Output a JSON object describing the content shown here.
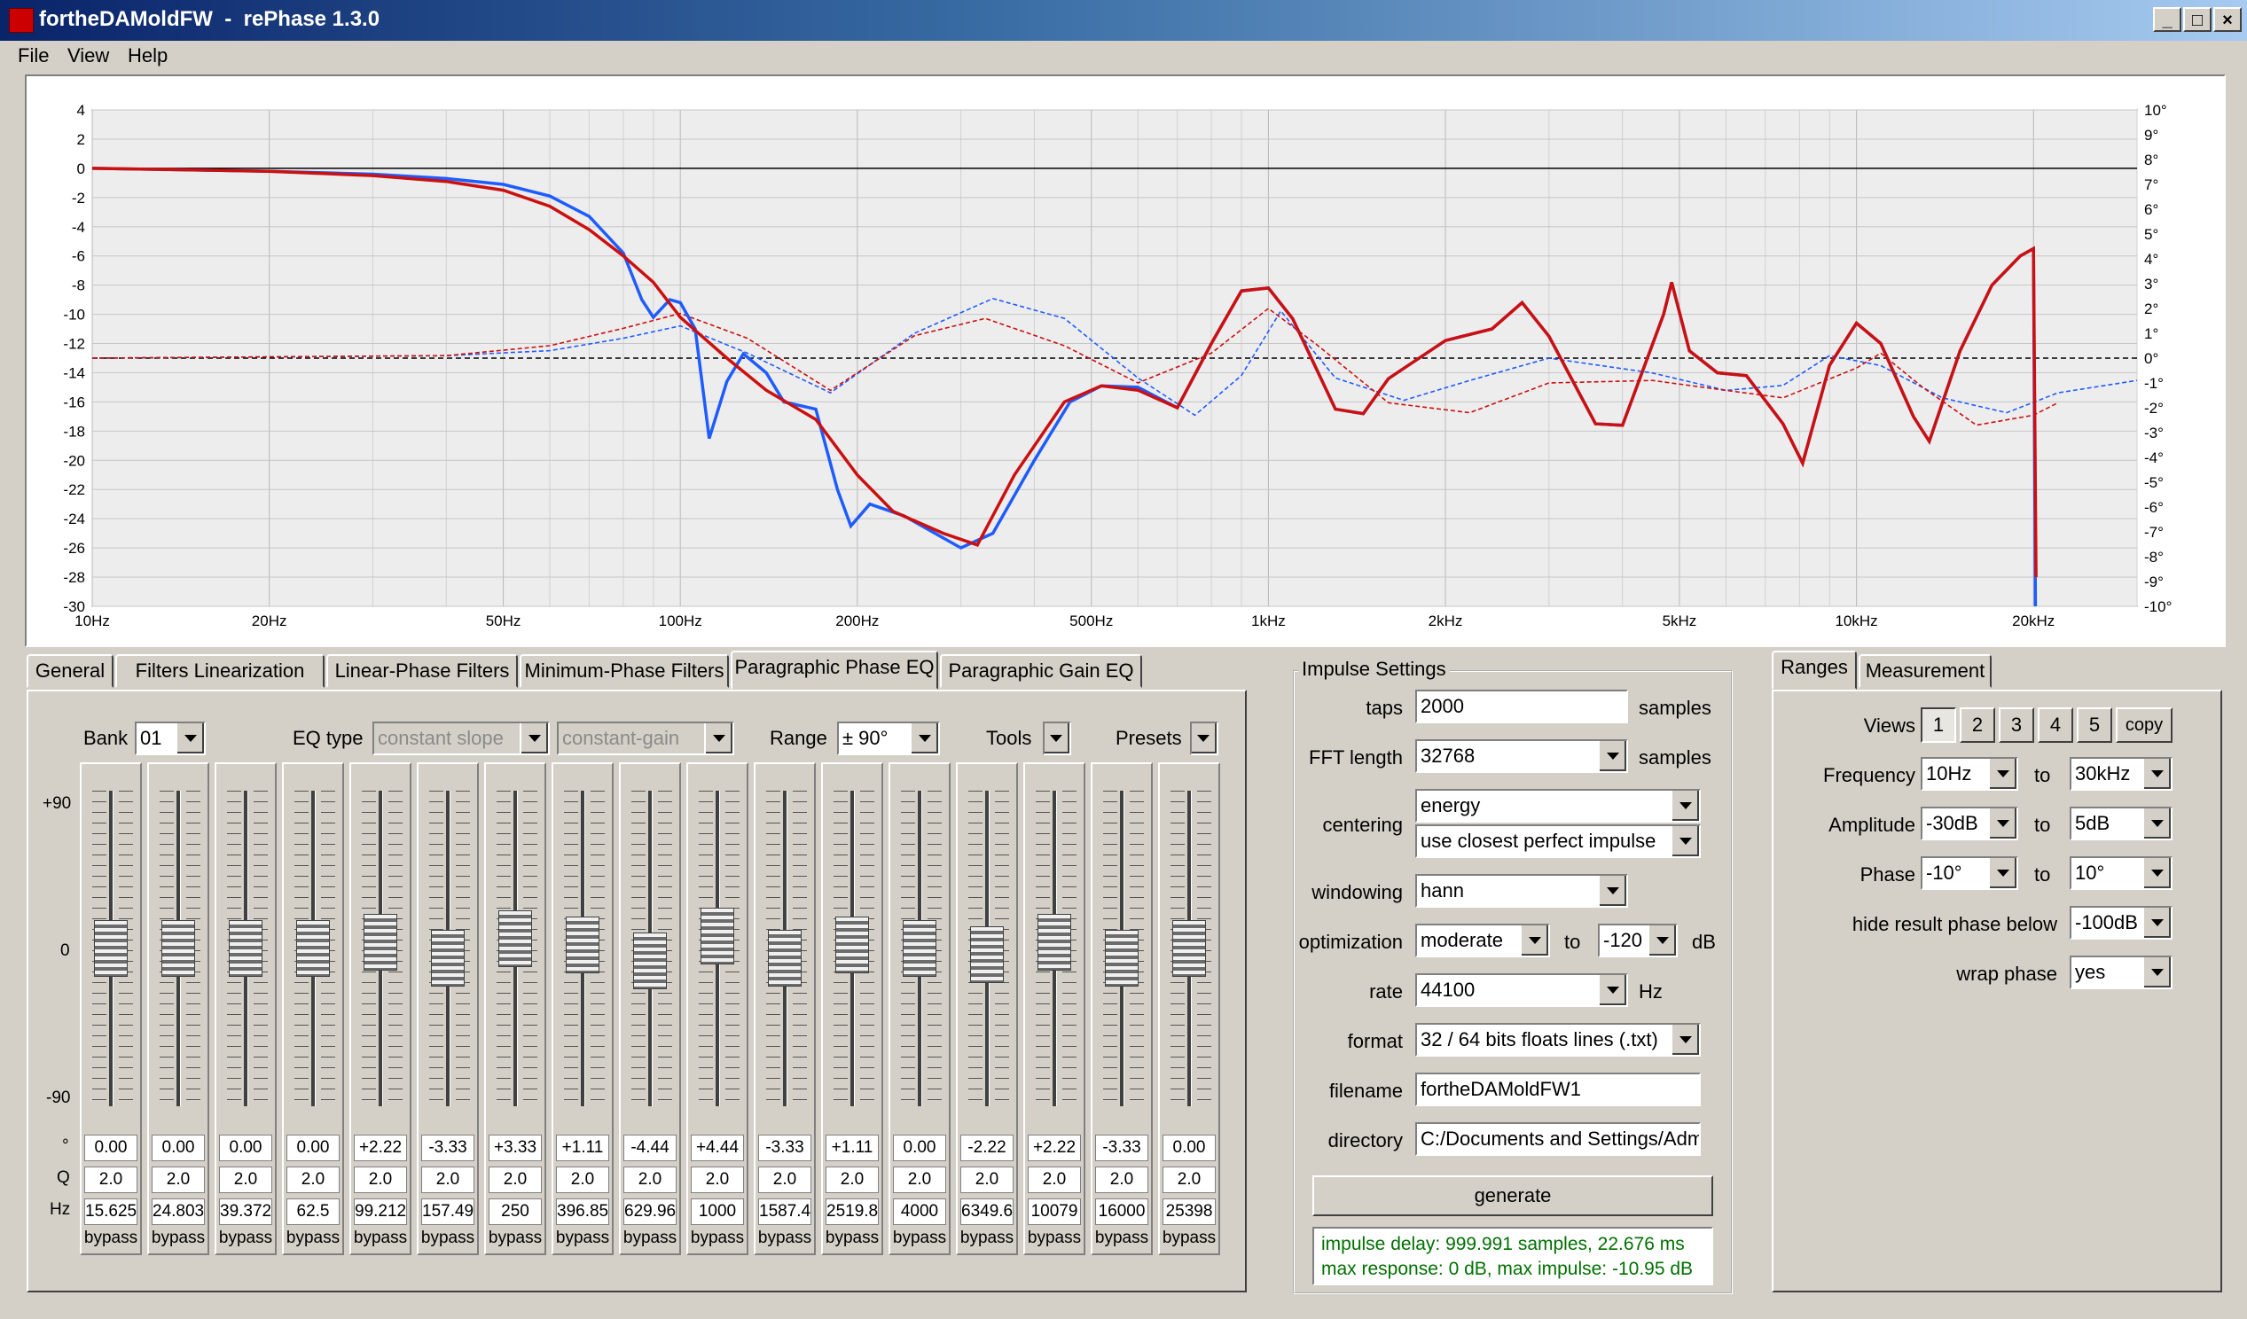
{
  "window": {
    "title": "fortheDAMoldFW  -  rePhase 1.3.0"
  },
  "menu": [
    "File",
    "View",
    "Help"
  ],
  "graph": {
    "left_ticks": [
      "4",
      "2",
      "0",
      "-2",
      "-4",
      "-6",
      "-8",
      "-10",
      "-12",
      "-14",
      "-16",
      "-18",
      "-20",
      "-22",
      "-24",
      "-26",
      "-28",
      "-30"
    ],
    "right_ticks": [
      "10°",
      "9°",
      "8°",
      "7°",
      "6°",
      "5°",
      "4°",
      "3°",
      "2°",
      "1°",
      "0°",
      "-1°",
      "-2°",
      "-3°",
      "-4°",
      "-5°",
      "-6°",
      "-7°",
      "-8°",
      "-9°",
      "-10°"
    ],
    "x_ticks": [
      "10Hz",
      "20Hz",
      "50Hz",
      "100Hz",
      "200Hz",
      "500Hz",
      "1kHz",
      "2kHz",
      "5kHz",
      "10kHz",
      "20kHz"
    ]
  },
  "tabs": [
    "General",
    "Filters Linearization",
    "Linear-Phase Filters",
    "Minimum-Phase Filters",
    "Paragraphic Phase EQ",
    "Paragraphic Gain EQ"
  ],
  "eq": {
    "bank_label": "Bank",
    "bank_value": "01",
    "eqtype_label": "EQ type",
    "eqtype_value1": "constant slope",
    "eqtype_value2": "constant-gain",
    "range_label": "Range",
    "range_value": "± 90°",
    "tools_label": "Tools",
    "presets_label": "Presets",
    "scale": [
      "+90",
      "0",
      "-90"
    ],
    "row_labels": [
      "°",
      "Q",
      "Hz"
    ],
    "bypass_label": "bypass",
    "bands": [
      {
        "deg": "0.00",
        "q": "2.0",
        "hz": "15.625",
        "level": 0
      },
      {
        "deg": "0.00",
        "q": "2.0",
        "hz": "24.803",
        "level": 0
      },
      {
        "deg": "0.00",
        "q": "2.0",
        "hz": "39.372",
        "level": 0
      },
      {
        "deg": "0.00",
        "q": "2.0",
        "hz": "62.5",
        "level": 0
      },
      {
        "deg": "+2.22",
        "q": "2.0",
        "hz": "99.212",
        "level": 2.22
      },
      {
        "deg": "-3.33",
        "q": "2.0",
        "hz": "157.49",
        "level": -3.33
      },
      {
        "deg": "+3.33",
        "q": "2.0",
        "hz": "250",
        "level": 3.33
      },
      {
        "deg": "+1.11",
        "q": "2.0",
        "hz": "396.85",
        "level": 1.11
      },
      {
        "deg": "-4.44",
        "q": "2.0",
        "hz": "629.96",
        "level": -4.44
      },
      {
        "deg": "+4.44",
        "q": "2.0",
        "hz": "1000",
        "level": 4.44
      },
      {
        "deg": "-3.33",
        "q": "2.0",
        "hz": "1587.4",
        "level": -3.33
      },
      {
        "deg": "+1.11",
        "q": "2.0",
        "hz": "2519.8",
        "level": 1.11
      },
      {
        "deg": "0.00",
        "q": "2.0",
        "hz": "4000",
        "level": 0
      },
      {
        "deg": "-2.22",
        "q": "2.0",
        "hz": "6349.6",
        "level": -2.22
      },
      {
        "deg": "+2.22",
        "q": "2.0",
        "hz": "10079",
        "level": 2.22
      },
      {
        "deg": "-3.33",
        "q": "2.0",
        "hz": "16000",
        "level": -3.33
      },
      {
        "deg": "0.00",
        "q": "2.0",
        "hz": "25398",
        "level": 0
      }
    ]
  },
  "impulse": {
    "title": "Impulse Settings",
    "taps_label": "taps",
    "taps_value": "2000",
    "samples1": "samples",
    "fft_label": "FFT length",
    "fft_value": "32768",
    "samples2": "samples",
    "centering_label": "centering",
    "centering_value1": "energy",
    "centering_value2": "use closest perfect impulse",
    "windowing_label": "windowing",
    "windowing_value": "hann",
    "optimization_label": "optimization",
    "optimization_value": "moderate",
    "to_label": "to",
    "optimization_to": "-120",
    "db_label": "dB",
    "rate_label": "rate",
    "rate_value": "44100",
    "hz_label": "Hz",
    "format_label": "format",
    "format_value": "32 / 64 bits floats lines (.txt)",
    "filename_label": "filename",
    "filename_value": "fortheDAMoldFW1",
    "directory_label": "directory",
    "directory_value": "C:/Documents and Settings/Admi",
    "generate_label": "generate",
    "status_line1": "impulse delay: 999.991 samples, 22.676 ms",
    "status_line2": "max response: 0 dB, max impulse: -10.95 dB"
  },
  "ranges": {
    "tabs": [
      "Ranges",
      "Measurement"
    ],
    "views_label": "Views",
    "views": [
      "1",
      "2",
      "3",
      "4",
      "5"
    ],
    "copy_label": "copy",
    "frequency_label": "Frequency",
    "freq_from": "10Hz",
    "freq_to": "30kHz",
    "amplitude_label": "Amplitude",
    "amp_from": "-30dB",
    "amp_to": "5dB",
    "phase_label": "Phase",
    "phase_from": "-10°",
    "phase_to": "10°",
    "to_label": "to",
    "hide_label": "hide result phase below",
    "hide_value": "-100dB",
    "wrap_label": "wrap phase",
    "wrap_value": "yes"
  },
  "colors": {
    "blue_trace": "#1e5cff",
    "red_trace": "#cc1010",
    "status_text": "#007000",
    "title_bar": "#0a246a"
  }
}
